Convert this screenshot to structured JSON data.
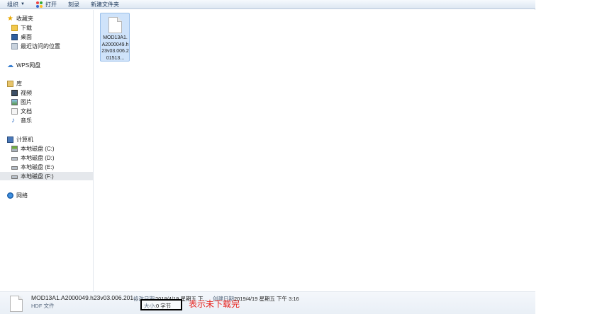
{
  "toolbar": {
    "organize": "组织",
    "open": "打开",
    "burn": "刻录",
    "new_folder": "新建文件夹"
  },
  "nav": {
    "favorites": {
      "label": "收藏夹",
      "items": [
        {
          "label": "下载",
          "icon": "downloads-icon"
        },
        {
          "label": "桌面",
          "icon": "desktop-icon"
        },
        {
          "label": "最近访问的位置",
          "icon": "recent-places-icon"
        }
      ]
    },
    "wps": {
      "label": "WPS网盘",
      "icon": "cloud-icon"
    },
    "libraries": {
      "label": "库",
      "items": [
        {
          "label": "视频",
          "icon": "video-icon"
        },
        {
          "label": "图片",
          "icon": "pictures-icon"
        },
        {
          "label": "文档",
          "icon": "documents-icon"
        },
        {
          "label": "音乐",
          "icon": "music-icon"
        }
      ]
    },
    "computer": {
      "label": "计算机",
      "items": [
        {
          "label": "本地磁盘 (C:)",
          "icon": "system-drive-icon"
        },
        {
          "label": "本地磁盘 (D:)",
          "icon": "drive-icon"
        },
        {
          "label": "本地磁盘 (E:)",
          "icon": "drive-icon"
        },
        {
          "label": "本地磁盘 (F:)",
          "icon": "drive-icon",
          "selected": true
        }
      ]
    },
    "network": {
      "label": "网络",
      "icon": "network-icon"
    }
  },
  "content": {
    "file": {
      "name": "MOD13A1.A2000049.h23v03.006.201513..."
    }
  },
  "details": {
    "name": "MOD13A1.A2000049.h23v03.006.201...",
    "type": "HDF 文件",
    "modified_label": "修改日期:",
    "modified_value": "2019/4/19 星期五 下...",
    "created_label": "创建日期:",
    "created_value": "2019/4/19 星期五 下午 3:16",
    "size_label": "大小:",
    "size_value": "0 字节"
  },
  "annotation": "表示未下载完",
  "colors": {
    "accent": "#cfe3fa",
    "annotation": "#e8211c",
    "highlight_box": "#000000"
  }
}
